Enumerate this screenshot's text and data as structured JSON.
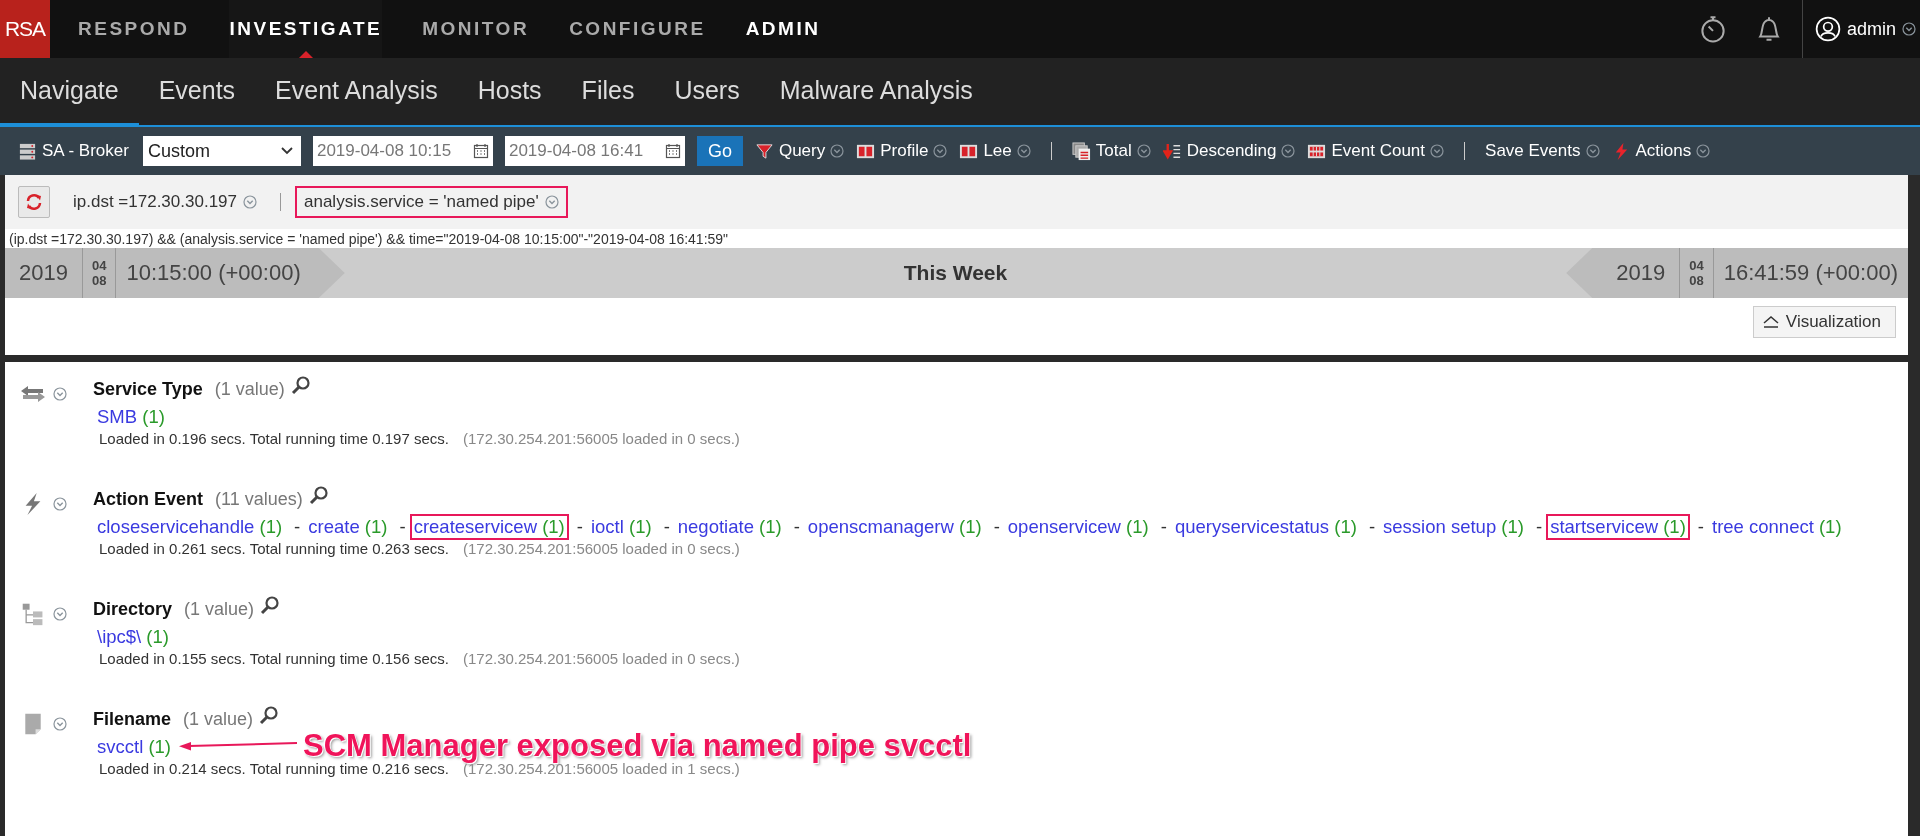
{
  "top_nav": {
    "logo": "RSA",
    "items": [
      {
        "label": "RESPOND",
        "selected": false,
        "bright": false
      },
      {
        "label": "INVESTIGATE",
        "selected": true,
        "bright": true
      },
      {
        "label": "MONITOR",
        "selected": false,
        "bright": false
      },
      {
        "label": "CONFIGURE",
        "selected": false,
        "bright": false
      },
      {
        "label": "ADMIN",
        "selected": false,
        "bright": true
      }
    ],
    "user": "admin"
  },
  "tabs": [
    {
      "label": "Navigate",
      "selected": true
    },
    {
      "label": "Events",
      "selected": false
    },
    {
      "label": "Event Analysis",
      "selected": false
    },
    {
      "label": "Hosts",
      "selected": false
    },
    {
      "label": "Files",
      "selected": false
    },
    {
      "label": "Users",
      "selected": false
    },
    {
      "label": "Malware Analysis",
      "selected": false
    }
  ],
  "toolbar": {
    "service": "SA - Broker",
    "range": "Custom",
    "start": "2019-04-08 10:15",
    "end": "2019-04-08 16:41",
    "go": "Go",
    "items": [
      {
        "label": "Query",
        "kind": "funnel",
        "divider_before": false
      },
      {
        "label": "Profile",
        "kind": "profile",
        "divider_before": false
      },
      {
        "label": "Lee",
        "kind": "profile",
        "divider_before": false
      },
      {
        "label": "Total",
        "kind": "stack",
        "divider_before": true
      },
      {
        "label": "Descending",
        "kind": "sort",
        "divider_before": false
      },
      {
        "label": "Event Count",
        "kind": "grid",
        "divider_before": false
      },
      {
        "label": "Save Events",
        "kind": "none",
        "divider_before": true
      },
      {
        "label": "Actions",
        "kind": "bolt",
        "divider_before": false
      }
    ]
  },
  "filters": [
    {
      "text": "ip.dst =172.30.30.197",
      "highlighted": false
    },
    {
      "text": "analysis.service = 'named pipe'",
      "highlighted": true
    }
  ],
  "query_string": "(ip.dst =172.30.30.197) && (analysis.service = 'named pipe') && time=\"2019-04-08 10:15:00\"-\"2019-04-08 16:41:59\"",
  "timebar": {
    "start": {
      "year": "2019",
      "month": "04",
      "day": "08",
      "time": "10:15:00 (+00:00)"
    },
    "label": "This Week",
    "end": {
      "year": "2019",
      "month": "04",
      "day": "08",
      "time": "16:41:59 (+00:00)"
    }
  },
  "visualization_button": "Visualization",
  "sections": [
    {
      "title": "Service Type",
      "count": "(1 value)",
      "kind": "arrows",
      "values": [
        {
          "text": "SMB",
          "count": "(1)",
          "highlighted": false
        }
      ],
      "timing": "Loaded in 0.196 secs. Total running time 0.197 secs.",
      "source": "(172.30.254.201:56005 loaded in 0 secs.)"
    },
    {
      "title": "Action Event",
      "count": "(11 values)",
      "kind": "bolt",
      "values": [
        {
          "text": "closeservicehandle",
          "count": "(1)",
          "highlighted": false
        },
        {
          "prefix": "-",
          "text": "create",
          "count": "(1)",
          "highlighted": false
        },
        {
          "prefix": "-",
          "text": "createservicew",
          "count": "(1)",
          "highlighted": true
        },
        {
          "prefix": "-",
          "text": "ioctl",
          "count": "(1)",
          "highlighted": false
        },
        {
          "prefix": "-",
          "text": "negotiate",
          "count": "(1)",
          "highlighted": false
        },
        {
          "prefix": "-",
          "text": "openscmanagerw",
          "count": "(1)",
          "highlighted": false
        },
        {
          "prefix": "-",
          "text": "openservicew",
          "count": "(1)",
          "highlighted": false
        },
        {
          "prefix": "-",
          "text": "queryservicestatus",
          "count": "(1)",
          "highlighted": false
        },
        {
          "prefix": "-",
          "text": "session setup",
          "count": "(1)",
          "highlighted": false
        },
        {
          "prefix": "-",
          "text": "startservicew",
          "count": "(1)",
          "highlighted": true
        },
        {
          "prefix": "-",
          "text": "tree connect",
          "count": "(1)",
          "highlighted": false
        }
      ],
      "timing": "Loaded in 0.261 secs. Total running time 0.263 secs.",
      "source": "(172.30.254.201:56005 loaded in 0 secs.)"
    },
    {
      "title": "Directory",
      "count": "(1 value)",
      "kind": "tree",
      "values": [
        {
          "text": "\\ipc$\\",
          "count": "(1)",
          "highlighted": false
        }
      ],
      "timing": "Loaded in 0.155 secs. Total running time 0.156 secs.",
      "source": "(172.30.254.201:56005 loaded in 0 secs.)"
    },
    {
      "title": "Filename",
      "count": "(1 value)",
      "kind": "file",
      "values": [
        {
          "text": "svcctl",
          "count": "(1)",
          "highlighted": false
        }
      ],
      "timing": "Loaded in 0.214 secs. Total running time 0.216 secs.",
      "source": "(172.30.254.201:56005 loaded in 1 secs.)",
      "annotation": "SCM Manager exposed via named pipe svcctl"
    }
  ]
}
